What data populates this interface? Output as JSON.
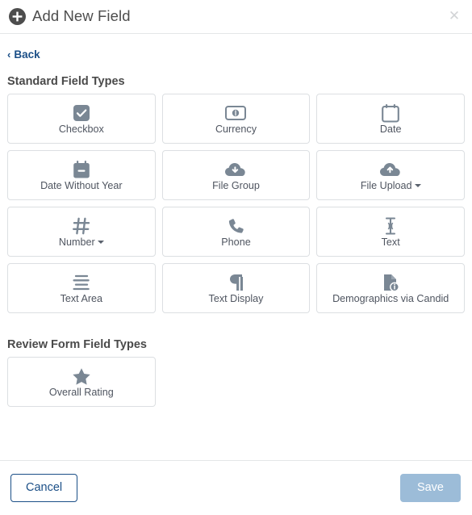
{
  "header": {
    "title": "Add New Field",
    "add_icon": "plus-circle-icon",
    "close_label": "✕"
  },
  "nav": {
    "back_label": "Back",
    "back_chevron": "‹"
  },
  "sections": [
    {
      "title": "Standard Field Types",
      "cards": [
        {
          "label": "Checkbox",
          "icon": "checkbox-checked-icon",
          "caret": false
        },
        {
          "label": "Currency",
          "icon": "money-bill-icon",
          "caret": false
        },
        {
          "label": "Date",
          "icon": "calendar-icon",
          "caret": false
        },
        {
          "label": "Date Without Year",
          "icon": "calendar-minus-icon",
          "caret": false
        },
        {
          "label": "File Group",
          "icon": "cloud-download-icon",
          "caret": false
        },
        {
          "label": "File Upload",
          "icon": "cloud-upload-icon",
          "caret": true
        },
        {
          "label": "Number",
          "icon": "hashtag-icon",
          "caret": true
        },
        {
          "label": "Phone",
          "icon": "phone-icon",
          "caret": false
        },
        {
          "label": "Text",
          "icon": "text-cursor-icon",
          "caret": false
        },
        {
          "label": "Text Area",
          "icon": "align-left-icon",
          "caret": false
        },
        {
          "label": "Text Display",
          "icon": "pilcrow-icon",
          "caret": false
        },
        {
          "label": "Demographics via Candid",
          "icon": "file-info-icon",
          "caret": false
        }
      ]
    },
    {
      "title": "Review Form Field Types",
      "cards": [
        {
          "label": "Overall Rating",
          "icon": "star-icon",
          "caret": false
        }
      ]
    }
  ],
  "footer": {
    "cancel_label": "Cancel",
    "save_label": "Save"
  },
  "colors": {
    "link": "#1b4f87",
    "icon": "#7a8794",
    "card_border": "#dcdfe2",
    "save_disabled": "#9cbcd8"
  }
}
